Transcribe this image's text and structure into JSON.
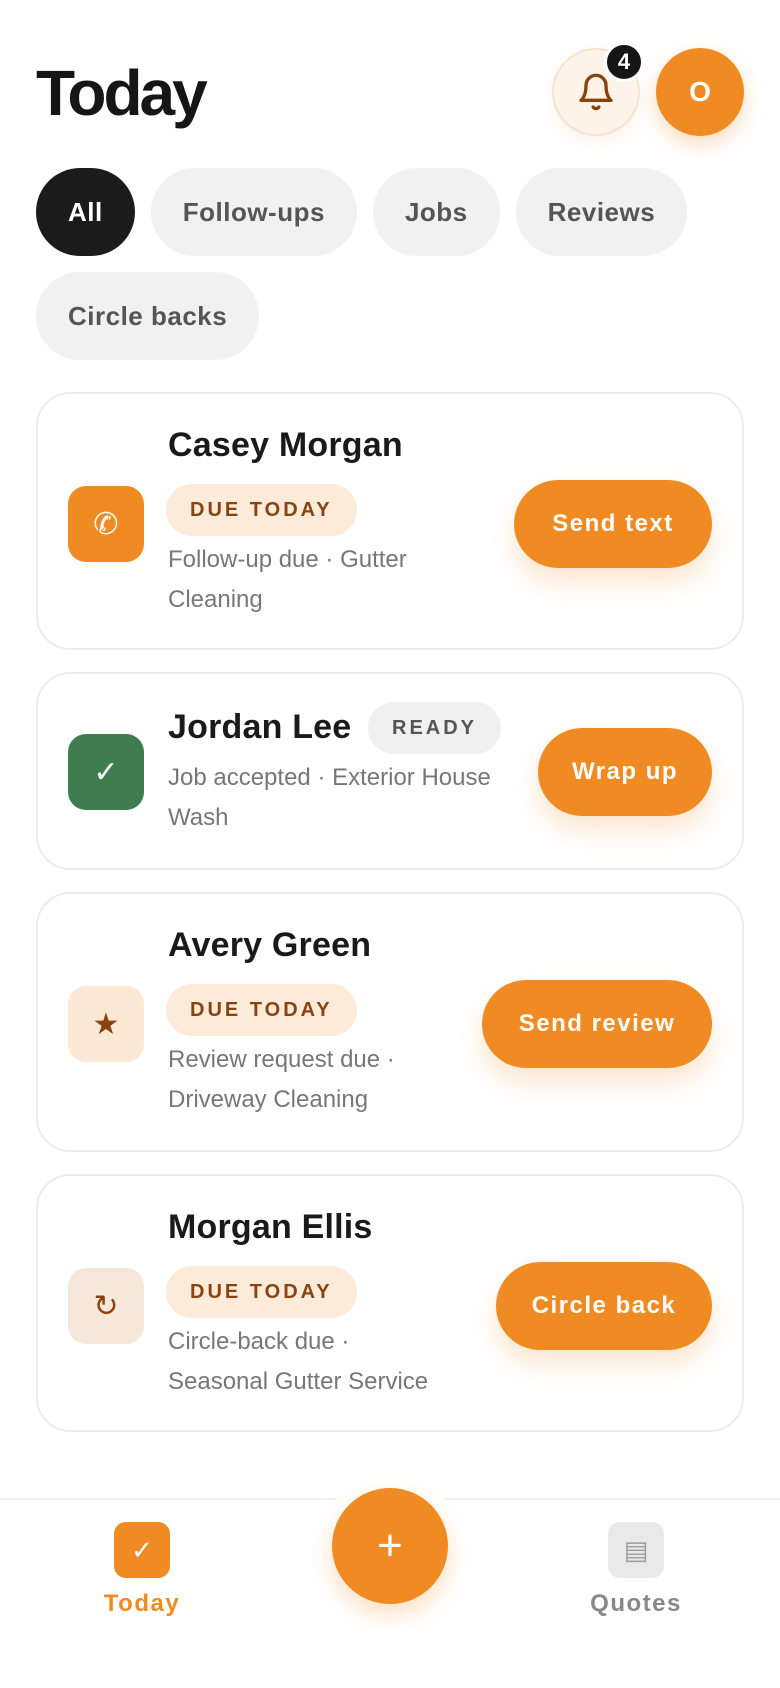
{
  "header": {
    "title": "Today",
    "notification_count": "4",
    "avatar_initial": "O"
  },
  "filters": [
    {
      "label": "All",
      "active": true
    },
    {
      "label": "Follow-ups",
      "active": false
    },
    {
      "label": "Jobs",
      "active": false
    },
    {
      "label": "Reviews",
      "active": false
    },
    {
      "label": "Circle backs",
      "active": false
    }
  ],
  "tasks": [
    {
      "name": "Casey Morgan",
      "badge": "DUE TODAY",
      "description_line1": "Follow-up due · Gutter",
      "description_line2": "Cleaning",
      "action": "Send text",
      "icon": "phone-icon",
      "icon_glyph": "✆",
      "icon_bg": "#ef8b22",
      "icon_color": "#ffffff"
    },
    {
      "name": "Jordan Lee",
      "badge": "READY",
      "description_line1": "Job accepted · Exterior House",
      "description_line2": "Wash",
      "action": "Wrap up",
      "icon": "check-icon",
      "icon_glyph": "✓",
      "icon_bg": "#3f7d4e",
      "icon_color": "#ffffff"
    },
    {
      "name": "Avery Green",
      "badge": "DUE TODAY",
      "description_line1": "Review request due ·",
      "description_line2": "Driveway Cleaning",
      "action": "Send review",
      "icon": "star-icon",
      "icon_glyph": "★",
      "icon_bg": "#fbe8d5",
      "icon_color": "#8a4310"
    },
    {
      "name": "Morgan Ellis",
      "badge": "DUE TODAY",
      "description_line1": "Circle-back due ·",
      "description_line2": "Seasonal Gutter Service",
      "action": "Circle back",
      "icon": "refresh-icon",
      "icon_glyph": "↻",
      "icon_bg": "#f5e8db",
      "icon_color": "#8a4310"
    }
  ],
  "bottom_nav": {
    "today_label": "Today",
    "today_glyph": "✓",
    "add_glyph": "+",
    "quotes_label": "Quotes",
    "quotes_glyph": "▤"
  },
  "colors": {
    "accent": "#ef8b22",
    "dark": "#1b1b1b",
    "chip_bg": "#f1f1f1",
    "badge_due_bg": "#fcebd8",
    "badge_due_text": "#8a4310"
  }
}
